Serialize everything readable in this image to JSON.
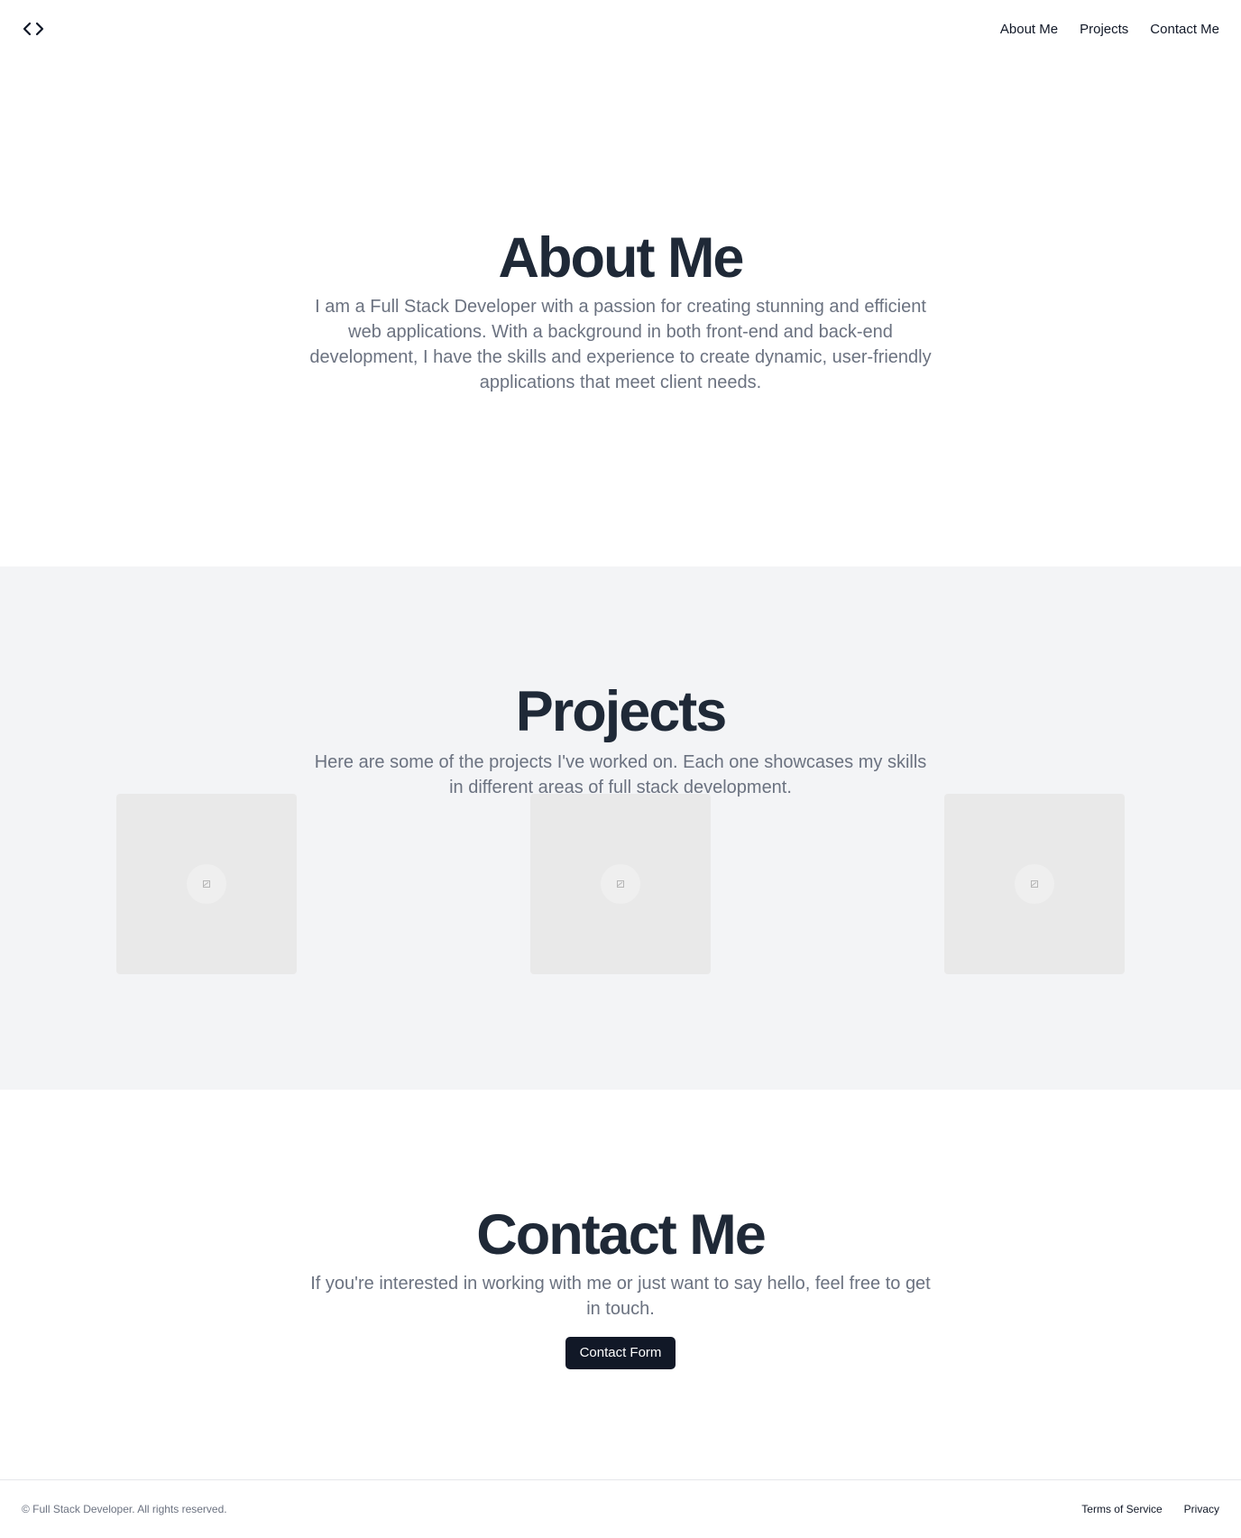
{
  "header": {
    "logo_icon": "code-brackets-icon",
    "nav": [
      "About Me",
      "Projects",
      "Contact Me"
    ]
  },
  "about": {
    "title": "About Me",
    "description": "I am a Full Stack Developer with a passion for creating stunning and efficient web applications. With a background in both front-end and back-end development, I have the skills and experience to create dynamic, user-friendly applications that meet client needs."
  },
  "projects": {
    "title": "Projects",
    "description": "Here are some of the projects I've worked on. Each one showcases my skills in different areas of full stack development.",
    "cards": [
      {
        "image_icon": "image-placeholder-icon"
      },
      {
        "image_icon": "image-placeholder-icon"
      },
      {
        "image_icon": "image-placeholder-icon"
      }
    ]
  },
  "contact": {
    "title": "Contact Me",
    "description": "If you're interested in working with me or just want to say hello, feel free to get in touch.",
    "button_label": "Contact Form"
  },
  "footer": {
    "copyright": "© Full Stack Developer. All rights reserved.",
    "links": [
      "Terms of Service",
      "Privacy"
    ]
  },
  "colors": {
    "heading": "#1f2937",
    "muted_text": "#6b7280",
    "section_bg": "#f3f4f6",
    "button_bg": "#111827"
  }
}
